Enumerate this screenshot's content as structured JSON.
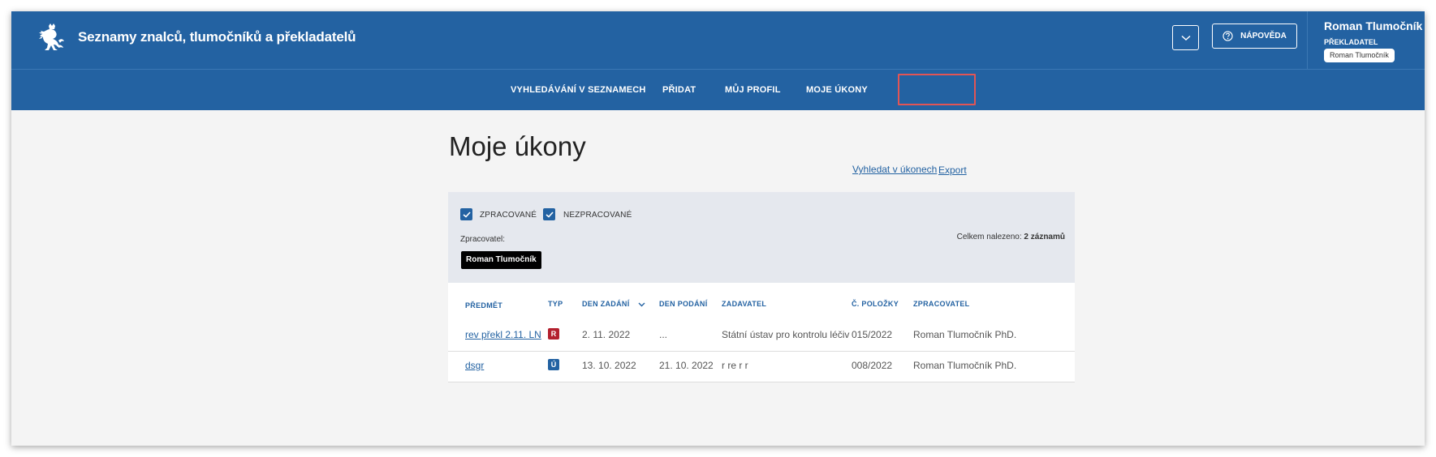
{
  "header": {
    "app_title": "Seznamy znalců, tlumočníků a překladatelů",
    "help_label": "NÁPOVĚDA",
    "user_name": "Roman Tlumočník",
    "user_role": "PŘEKLADATEL",
    "user_chip": "Roman Tlumočník"
  },
  "nav": {
    "items": [
      {
        "label": "VYHLEDÁVÁNÍ V SEZNAMECH"
      },
      {
        "label": "PŘIDAT"
      },
      {
        "label": "MŮJ PROFIL"
      },
      {
        "label": "MOJE ÚKONY",
        "active": true
      }
    ]
  },
  "main": {
    "title": "Moje úkony",
    "search_link": "Vyhledat v úkonech",
    "export_link": "Export"
  },
  "filters": {
    "processed_label": "ZPRACOVANÉ",
    "processed_checked": true,
    "unprocessed_label": "NEZPRACOVANÉ",
    "unprocessed_checked": true,
    "processor_label": "Zpracovatel:",
    "processor_tag": "Roman Tlumočník",
    "found_prefix": "Celkem nalezeno:",
    "found_count": "2 záznamů"
  },
  "table": {
    "columns": [
      "PŘEDMĚT",
      "TYP",
      "DEN ZADÁNÍ",
      "DEN PODÁNÍ",
      "ZADAVATEL",
      "Č. POLOŽKY",
      "ZPRACOVATEL"
    ],
    "rows": [
      {
        "subject": "rev překl 2.11. LN",
        "type": "R",
        "type_color": "#b3202e",
        "assigned": "2. 11. 2022",
        "submitted": "...",
        "client": "Státní ústav pro kontrolu léčiv",
        "item_no": "015/2022",
        "processor": "Roman Tlumočník PhD."
      },
      {
        "subject": "dsgr",
        "type": "Ú",
        "type_color": "#2362a2",
        "assigned": "13. 10. 2022",
        "submitted": "21. 10. 2022",
        "client": "r re r r",
        "item_no": "008/2022",
        "processor": "Roman Tlumočník PhD."
      }
    ]
  },
  "colors": {
    "primary": "#2362a2",
    "active_nav_outline": "#e25555",
    "filter_panel_bg": "#e5e8ee"
  }
}
